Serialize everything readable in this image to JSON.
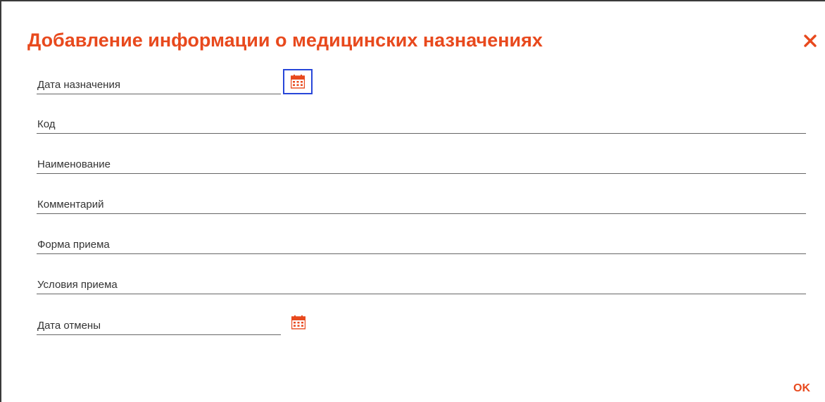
{
  "dialog": {
    "title": "Добавление информации о медицинских назначениях",
    "close_icon": "close-icon",
    "ok_label": "OK"
  },
  "fields": {
    "prescription_date": {
      "label": "Дата назначения",
      "value": ""
    },
    "code": {
      "label": "Код",
      "value": ""
    },
    "name": {
      "label": "Наименование",
      "value": ""
    },
    "comment": {
      "label": "Комментарий",
      "value": ""
    },
    "dosage_form": {
      "label": "Форма приема",
      "value": ""
    },
    "conditions": {
      "label": "Условия приема",
      "value": ""
    },
    "cancel_date": {
      "label": "Дата отмены",
      "value": ""
    }
  },
  "icons": {
    "calendar": "calendar-icon"
  },
  "colors": {
    "accent": "#e8491d",
    "focus": "#2847d9",
    "line": "#666666",
    "text": "#333333"
  }
}
